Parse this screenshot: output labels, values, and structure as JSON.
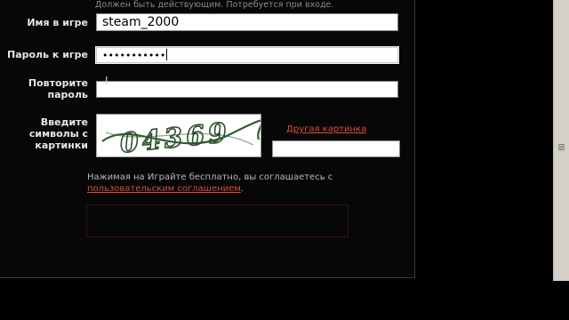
{
  "top_note": "Должен быть действующим. Потребуется при входе.",
  "form": {
    "username": {
      "label": "Имя в игре",
      "value": "steam_2000"
    },
    "password": {
      "label": "Пароль к игре",
      "value": "•••••••••••"
    },
    "repeat_password": {
      "label_line1": "Повторите",
      "label_line2": "пароль",
      "value": ""
    },
    "captcha": {
      "label_line1": "Введите",
      "label_line2": "символы с",
      "label_line3": "картинки",
      "image_text": "04369",
      "other_link": "Другая картинка",
      "value": ""
    }
  },
  "agreement": {
    "text": "Нажимая на Играйте бесплатно, вы соглашаетесь с",
    "link": "пользовательским соглашением",
    "suffix": "."
  },
  "colors": {
    "background": "#000000",
    "link": "#e0483e"
  },
  "cursor_icon": "i-beam-cursor-icon"
}
